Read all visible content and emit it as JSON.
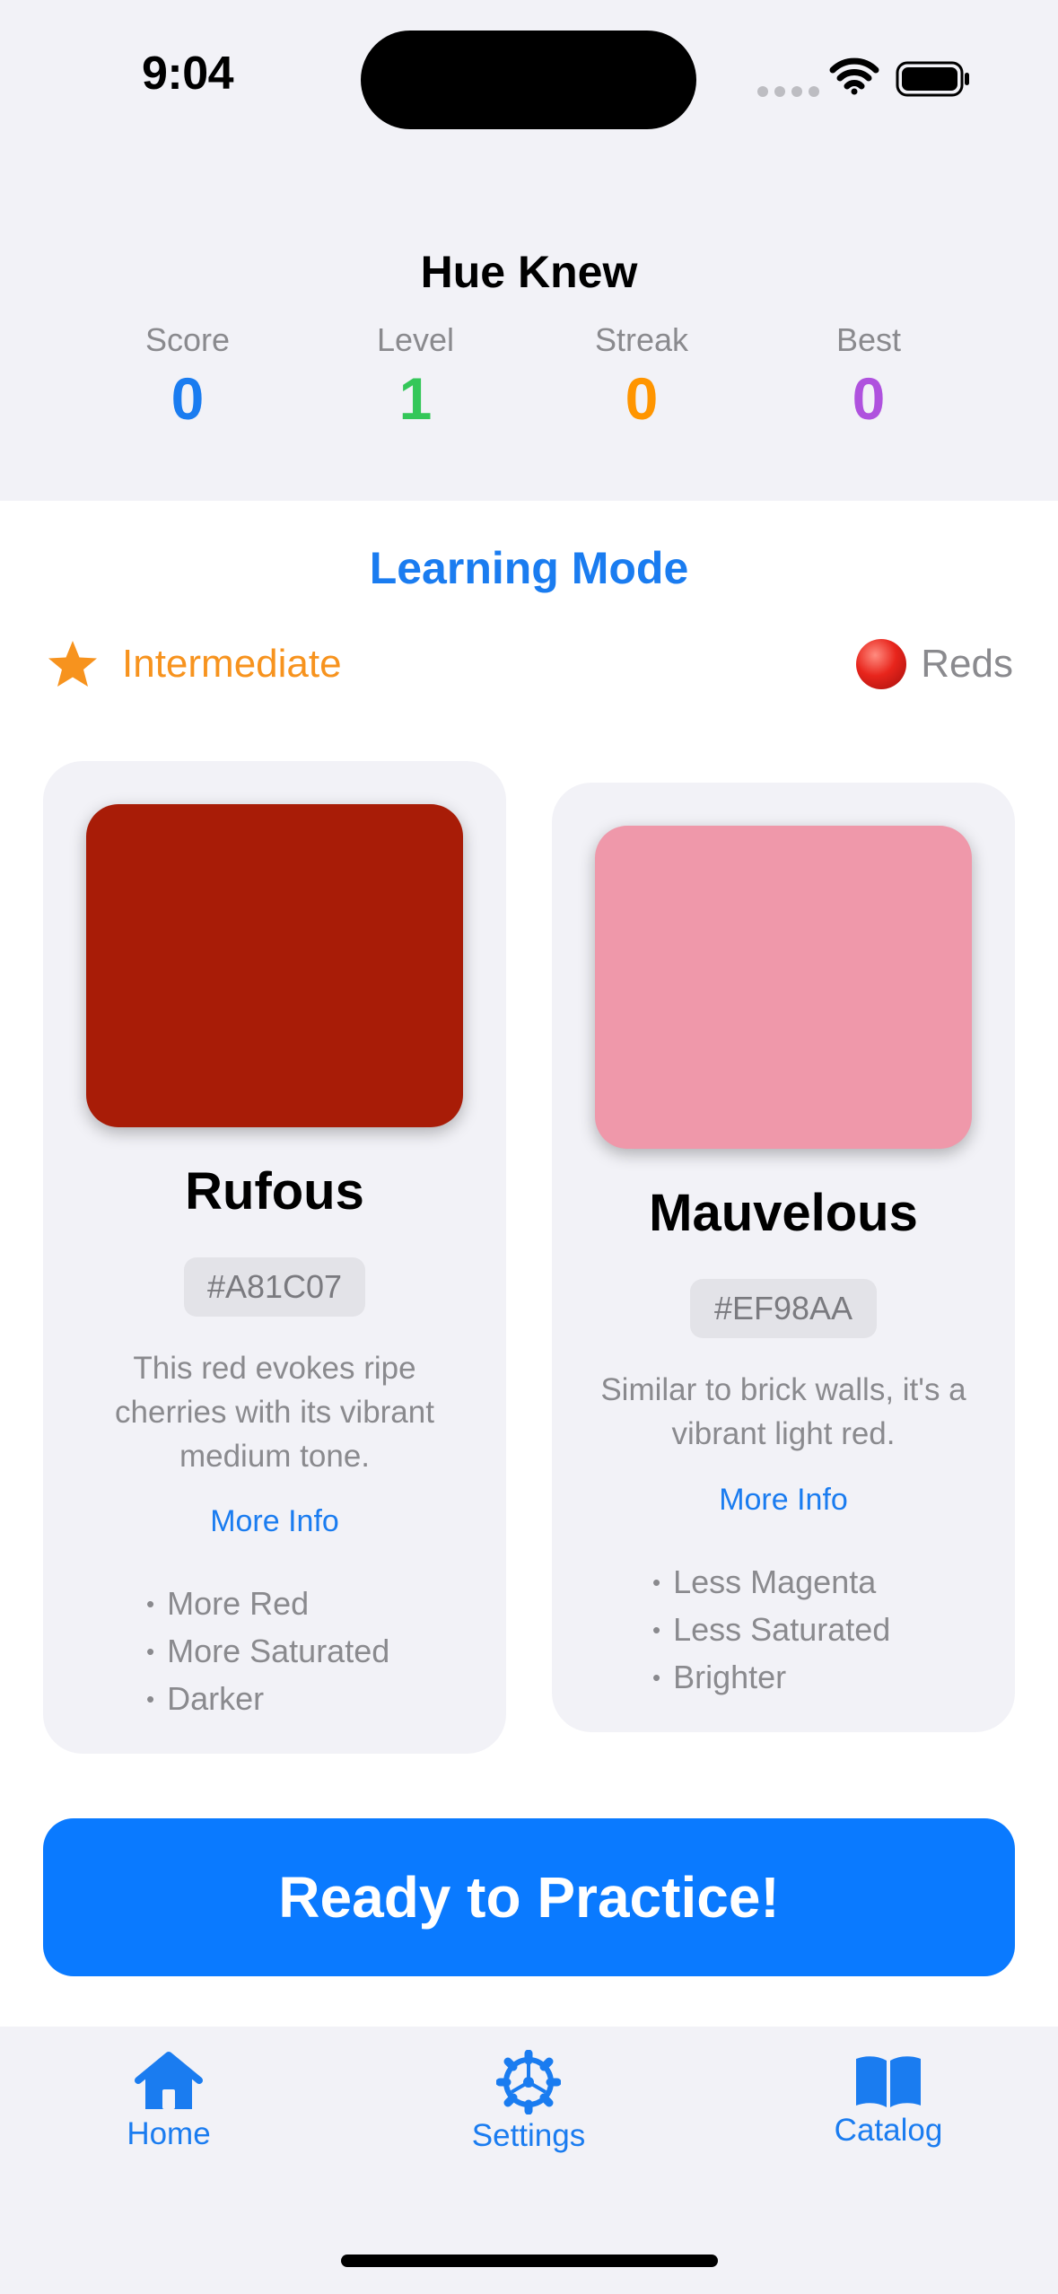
{
  "status_bar": {
    "time": "9:04"
  },
  "app": {
    "title": "Hue Knew"
  },
  "stats": [
    {
      "label": "Score",
      "value": "0",
      "color": "#1a7cf0"
    },
    {
      "label": "Level",
      "value": "1",
      "color": "#34c759"
    },
    {
      "label": "Streak",
      "value": "0",
      "color": "#ff9500"
    },
    {
      "label": "Best",
      "value": "0",
      "color": "#af52de"
    }
  ],
  "mode": {
    "title": "Learning Mode",
    "difficulty": {
      "label": "Intermediate",
      "icon": "star-icon"
    },
    "family": {
      "label": "Reds",
      "icon": "red-circle-icon"
    }
  },
  "cards": [
    {
      "name": "Rufous",
      "hex": "#A81C07",
      "description": "This red evokes ripe cherries with its vibrant medium tone.",
      "more_info": "More Info",
      "hints": [
        "More Red",
        "More Saturated",
        "Darker"
      ]
    },
    {
      "name": "Mauvelous",
      "hex": "#EF98AA",
      "description": "Similar to brick walls, it's a vibrant light red.",
      "more_info": "More Info",
      "hints": [
        "Less Magenta",
        "Less Saturated",
        "Brighter"
      ]
    }
  ],
  "practice_button": {
    "label": "Ready to Practice!"
  },
  "tabbar": {
    "items": [
      {
        "label": "Home",
        "icon": "house-icon"
      },
      {
        "label": "Settings",
        "icon": "gear-icon"
      },
      {
        "label": "Catalog",
        "icon": "book-icon"
      }
    ]
  }
}
